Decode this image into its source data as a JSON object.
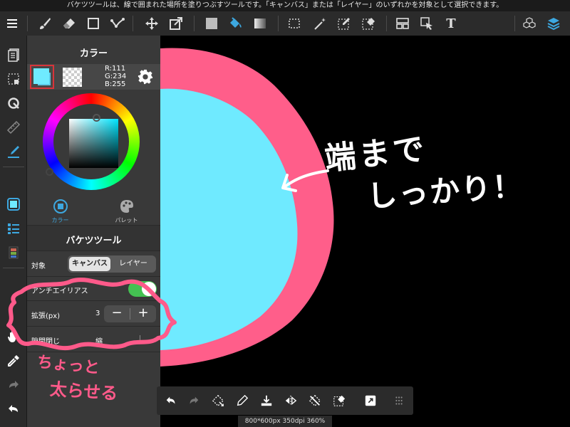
{
  "hint": "バケツツールは、線で囲まれた場所を塗りつぶすツールです。「キャンバス」または「レイヤー」のいずれかを対象として選択できます。",
  "toolbar": {
    "text_tool_glyph": "T",
    "icons": [
      "menu-icon",
      "brush-icon",
      "eraser-icon",
      "rectangle-icon",
      "dot-line-icon",
      "move-icon",
      "transform-icon",
      "fill-color-icon",
      "bucket-icon",
      "gradient-icon",
      "selection-icon",
      "magic-wand-icon",
      "select-pen-icon",
      "select-eraser-icon",
      "layout-icon",
      "select-arrow-icon",
      "text-icon",
      "3d-cubes-icon",
      "layers-icon"
    ]
  },
  "panel": {
    "title": "カラー",
    "rgb": {
      "r": "R:111",
      "g": "G:234",
      "b": "B:255"
    },
    "main_color": "#6feaff",
    "sub_color": "#5cc9e6",
    "tabs": [
      {
        "label": "カラー",
        "active": true
      },
      {
        "label": "パレット",
        "active": false
      }
    ],
    "tool_title": "バケツツール",
    "target_label": "対象",
    "target_options": [
      "キャンバス",
      "レイヤー"
    ],
    "target_selected": "キャンバス",
    "antialias_label": "アンチエイリアス",
    "antialias_on": true,
    "expand_label": "拡張(px)",
    "expand_value": "3",
    "stepper_minus": "−",
    "stepper_plus": "+",
    "close_gap_label": "隙間閉じ",
    "close_gap_value": "縮"
  },
  "annotations": {
    "canvas_note_line1": "端まで",
    "canvas_note_line2": "しっかり！",
    "panel_note_line1": "ちょっと",
    "panel_note_line2": "太らせる",
    "note_color_white": "#ffffff",
    "note_color_pink": "#ff5a8a"
  },
  "colors": {
    "fill_cyan": "#6feaff",
    "stroke_pink": "#ff5e8a",
    "accent_blue": "#3da8e0",
    "toggle_green": "#44c152"
  },
  "status": "800*600px 350dpi 360%"
}
